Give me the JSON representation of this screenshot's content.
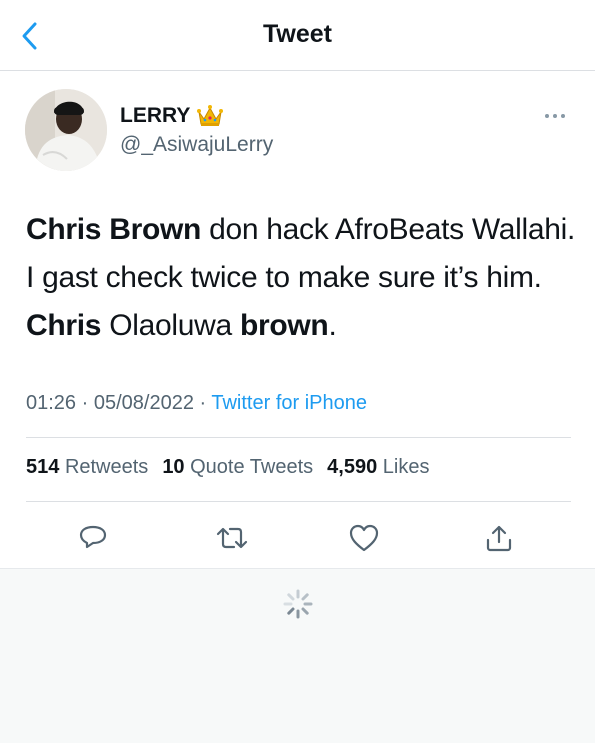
{
  "header": {
    "title": "Tweet",
    "back_icon": "chevron-left-icon"
  },
  "author": {
    "name": "LERRY",
    "emoji": "crown",
    "handle": "@_AsiwajuLerry"
  },
  "tweet": {
    "segments": [
      {
        "text": "Chris Brown",
        "bold": true
      },
      {
        "text": " don hack AfroBeats Wallahi. I gast check twice to make sure it’s him. ",
        "bold": false
      },
      {
        "text": "Chris",
        "bold": true
      },
      {
        "text": " Olaoluwa ",
        "bold": false
      },
      {
        "text": "brown",
        "bold": true
      },
      {
        "text": ".",
        "bold": false
      }
    ]
  },
  "meta": {
    "time": "01:26",
    "date": "05/08/2022",
    "source": "Twitter for iPhone"
  },
  "stats": {
    "retweets_count": "514",
    "retweets_label": "Retweets",
    "quotes_count": "10",
    "quotes_label": "Quote Tweets",
    "likes_count": "4,590",
    "likes_label": "Likes"
  },
  "actions": [
    "reply-icon",
    "retweet-icon",
    "like-icon",
    "share-icon"
  ],
  "colors": {
    "accent": "#1d9bf0",
    "text_primary": "#0f1419",
    "text_secondary": "#536471",
    "divider": "#dcdfe3"
  }
}
